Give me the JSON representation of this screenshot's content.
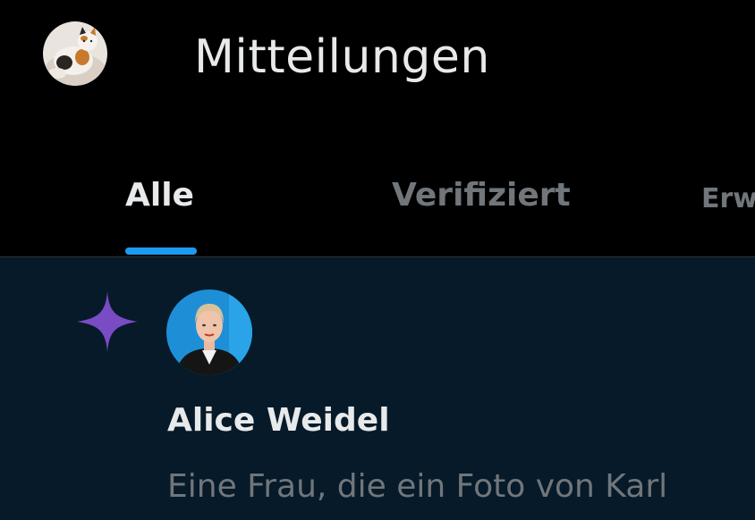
{
  "header": {
    "title": "Mitteilungen",
    "avatar_icon": "cat-avatar-icon"
  },
  "tabs": [
    {
      "label": "Alle",
      "active": true
    },
    {
      "label": "Verifiziert",
      "active": false
    },
    {
      "label": "Erw",
      "active": false
    }
  ],
  "notification": {
    "type_icon": "sparkle-star-icon",
    "user_name": "Alice Weidel",
    "text": "Eine Frau, die ein Foto von Karl"
  },
  "colors": {
    "background": "#000000",
    "notification_background": "#061a29",
    "text_primary": "#e7e9ea",
    "text_secondary": "#71767b",
    "accent": "#1d9bf0",
    "star": "#794bc4"
  }
}
